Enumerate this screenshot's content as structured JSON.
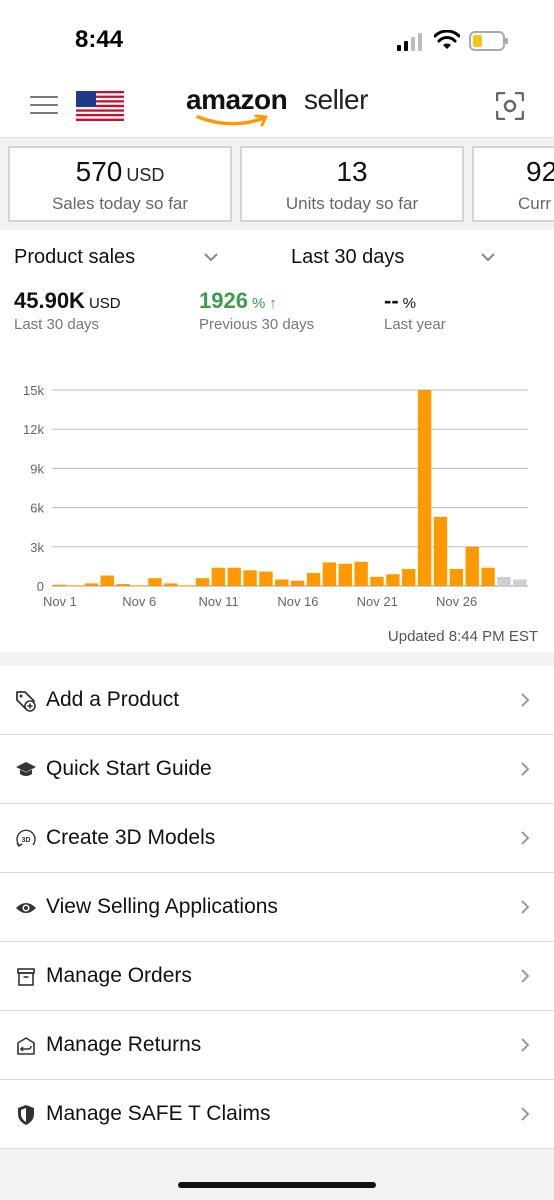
{
  "status_bar": {
    "time": "8:44"
  },
  "header": {
    "logo_brand": "amazon",
    "logo_suffix": "seller",
    "menu_icon": "hamburger-menu-icon",
    "flag_icon": "us-flag-icon",
    "scan_icon": "scan-icon"
  },
  "cards": [
    {
      "value": "570",
      "unit": "USD",
      "label": "Sales today so far"
    },
    {
      "value": "13",
      "unit": "",
      "label": "Units today so far"
    },
    {
      "value": "92",
      "unit": "",
      "label": "Curr"
    }
  ],
  "sales": {
    "metric_dropdown": "Product sales",
    "period_dropdown": "Last 30 days",
    "current": {
      "value": "45.90K",
      "unit": "USD",
      "label": "Last 30 days"
    },
    "previous": {
      "value": "1926",
      "unit": "%",
      "arrow": "↑",
      "label": "Previous 30 days"
    },
    "last_year": {
      "value": "--",
      "unit": "%",
      "label": "Last year"
    },
    "updated": "Updated 8:44 PM EST"
  },
  "chart_data": {
    "type": "bar",
    "categories": [
      "Nov 1",
      "Nov 2",
      "Nov 3",
      "Nov 4",
      "Nov 5",
      "Nov 6",
      "Nov 7",
      "Nov 8",
      "Nov 9",
      "Nov 10",
      "Nov 11",
      "Nov 12",
      "Nov 13",
      "Nov 14",
      "Nov 15",
      "Nov 16",
      "Nov 17",
      "Nov 18",
      "Nov 19",
      "Nov 20",
      "Nov 21",
      "Nov 22",
      "Nov 23",
      "Nov 24",
      "Nov 25",
      "Nov 26",
      "Nov 27",
      "Nov 28",
      "Nov 29",
      "Nov 30"
    ],
    "x_tick_labels": [
      "Nov 1",
      "Nov 6",
      "Nov 11",
      "Nov 16",
      "Nov 21",
      "Nov 26"
    ],
    "values": [
      100,
      50,
      200,
      800,
      150,
      50,
      600,
      200,
      50,
      600,
      1400,
      1400,
      1200,
      1100,
      500,
      400,
      1000,
      1800,
      1700,
      1850,
      700,
      900,
      1300,
      15000,
      5300,
      1300,
      3000,
      1400,
      700,
      500
    ],
    "bar_colors": [
      "#ff9900",
      "#ff9900",
      "#ff9900",
      "#ff9900",
      "#ff9900",
      "#ff9900",
      "#ff9900",
      "#ff9900",
      "#ff9900",
      "#ff9900",
      "#ff9900",
      "#ff9900",
      "#ff9900",
      "#ff9900",
      "#ff9900",
      "#ff9900",
      "#ff9900",
      "#ff9900",
      "#ff9900",
      "#ff9900",
      "#ff9900",
      "#ff9900",
      "#ff9900",
      "#ff9900",
      "#ff9900",
      "#ff9900",
      "#ff9900",
      "#ff9900",
      "#cfcfcf",
      "#cfcfcf"
    ],
    "y_ticks": [
      "0",
      "3k",
      "6k",
      "9k",
      "12k",
      "15k"
    ],
    "y_tick_values": [
      0,
      3000,
      6000,
      9000,
      12000,
      15000
    ],
    "ylim": [
      0,
      15000
    ],
    "grid": true
  },
  "list": [
    {
      "label": "Add a Product",
      "icon": "add-product-tag-icon"
    },
    {
      "label": "Quick Start Guide",
      "icon": "graduation-cap-icon"
    },
    {
      "label": "Create 3D Models",
      "icon": "3d-rotate-icon"
    },
    {
      "label": "View Selling Applications",
      "icon": "eye-icon"
    },
    {
      "label": "Manage Orders",
      "icon": "box-icon"
    },
    {
      "label": "Manage Returns",
      "icon": "return-box-icon"
    },
    {
      "label": "Manage SAFE T Claims",
      "icon": "shield-icon"
    }
  ]
}
